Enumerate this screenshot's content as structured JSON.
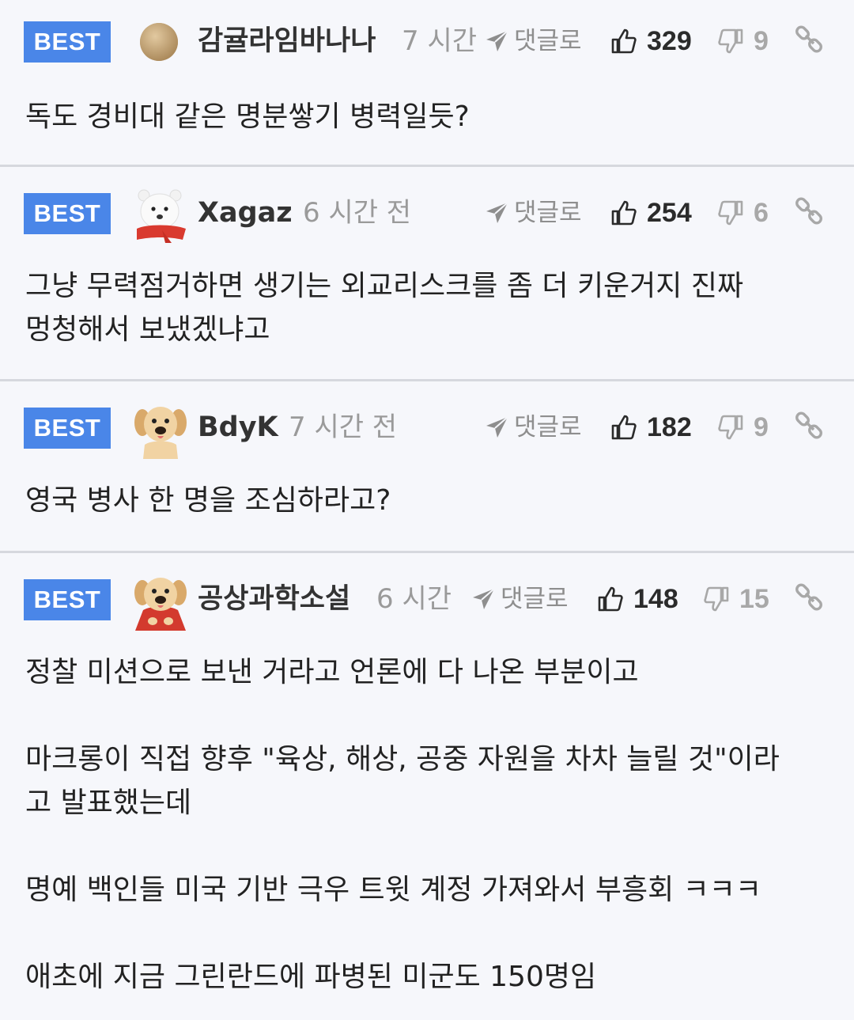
{
  "badge_label": "BEST",
  "reply_label": "댓글로",
  "comments": [
    {
      "nickname": "감귤라임바나나",
      "time": "7 시간",
      "likes": "329",
      "dislikes": "9",
      "avatar": "tan-circle-avatar",
      "body": [
        "독도 경비대 같은 명분쌓기 병력일듯?"
      ]
    },
    {
      "nickname": "Xagaz",
      "time": "6 시간 전",
      "likes": "254",
      "dislikes": "6",
      "avatar": "white-bear-avatar",
      "body": [
        "그냥 무력점거하면 생기는 외교리스크를 좀 더 키운거지 진짜",
        "멍청해서 보냈겠냐고"
      ]
    },
    {
      "nickname": "BdyK",
      "time": "7 시간 전",
      "likes": "182",
      "dislikes": "9",
      "avatar": "puppy-avatar",
      "body": [
        "영국 병사 한 명을 조심하라고?"
      ]
    },
    {
      "nickname": "공상과학소설",
      "time": "6 시간",
      "likes": "148",
      "dislikes": "15",
      "avatar": "puppy-red-cape-avatar",
      "body": [
        "정찰 미션으로 보낸 거라고 언론에 다 나온 부분이고",
        "마크롱이 직접 향후 \"육상, 해상, 공중 자원을 차차 늘릴 것\"이라",
        "고 발표했는데",
        "명예 백인들 미국 기반 극우 트윗 계정 가져와서 부흥회 ㅋㅋㅋ",
        "애초에 지금 그린란드에 파병된 미군도 150명임"
      ]
    }
  ],
  "colors": {
    "badge": "#4a86e8",
    "background": "#f6f7fb",
    "divider": "#d6d8de",
    "muted_text": "#9a9a9a"
  }
}
